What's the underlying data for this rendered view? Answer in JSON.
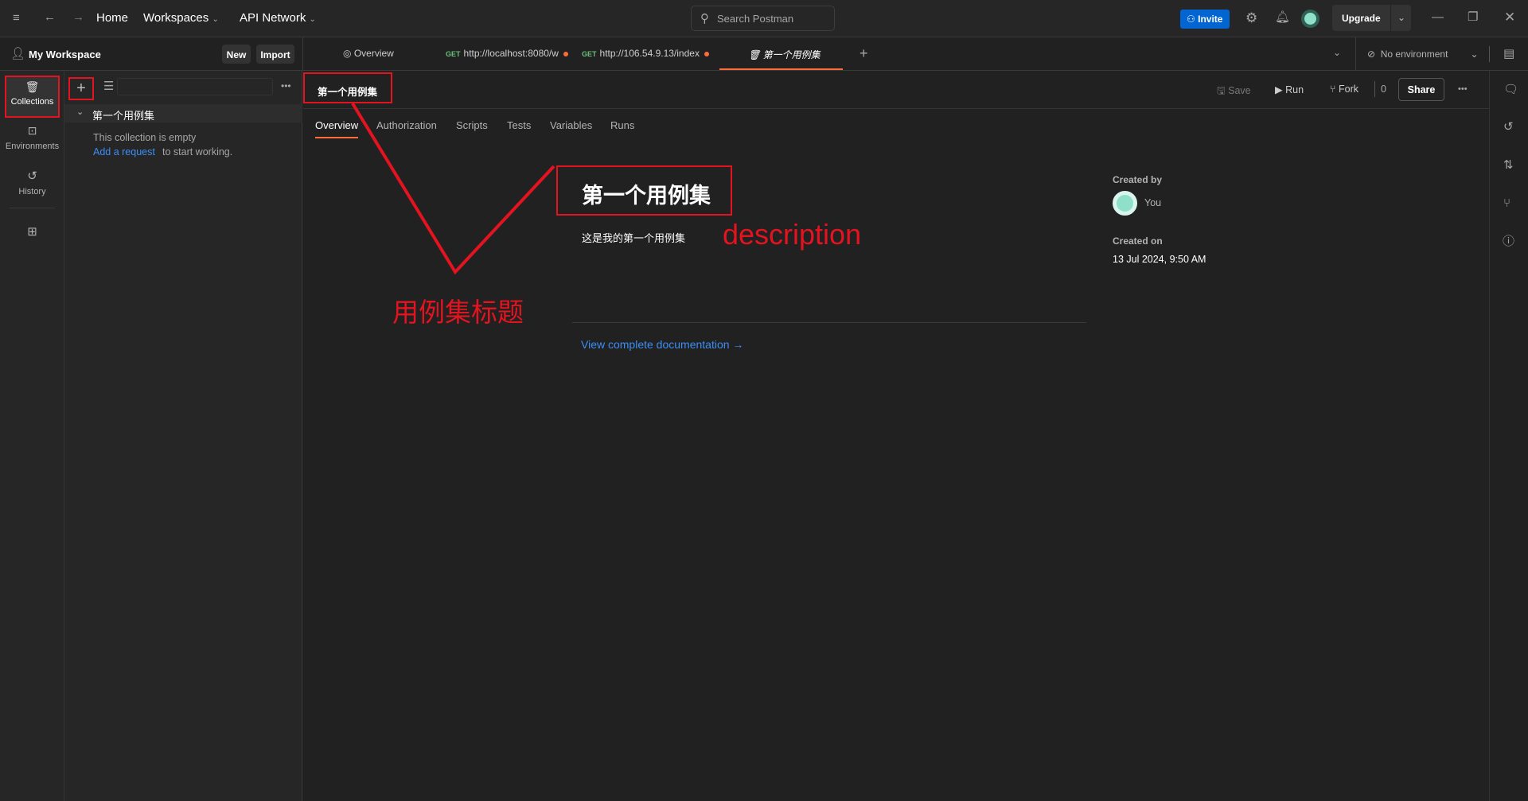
{
  "topbar": {
    "home": "Home",
    "workspaces": "Workspaces",
    "api_network": "API Network",
    "search_placeholder": "Search Postman",
    "invite": "Invite",
    "upgrade": "Upgrade"
  },
  "workspace": {
    "name": "My Workspace",
    "new": "New",
    "import": "Import"
  },
  "tabs": [
    {
      "label": "Overview"
    },
    {
      "method": "GET",
      "label": "http://localhost:8080/w"
    },
    {
      "method": "GET",
      "label": "http://106.54.9.13/index"
    },
    {
      "label": "第一个用例集"
    }
  ],
  "environment": "No environment",
  "rail": {
    "collections": "Collections",
    "environments": "Environments",
    "history": "History"
  },
  "sidebar": {
    "collection_name": "第一个用例集",
    "empty_text": "This collection is empty",
    "add_request": "Add a request",
    "to_start": "to start working."
  },
  "header": {
    "title": "第一个用例集",
    "save": "Save",
    "run": "Run",
    "fork": "Fork",
    "fork_count": "0",
    "share": "Share"
  },
  "subtabs": [
    "Overview",
    "Authorization",
    "Scripts",
    "Tests",
    "Variables",
    "Runs"
  ],
  "overview": {
    "title": "第一个用例集",
    "description": "这是我的第一个用例集",
    "created_by_label": "Created by",
    "created_by": "You",
    "created_on_label": "Created on",
    "created_on": "13 Jul 2024, 9:50 AM",
    "doc_link": "View complete documentation →"
  },
  "annotations": {
    "title_label": "用例集标题",
    "description_label": "description"
  },
  "colors": {
    "accent": "#ff6c37",
    "invite": "#0265d2",
    "link": "#3d8ef5",
    "annotation": "#e3141f"
  }
}
